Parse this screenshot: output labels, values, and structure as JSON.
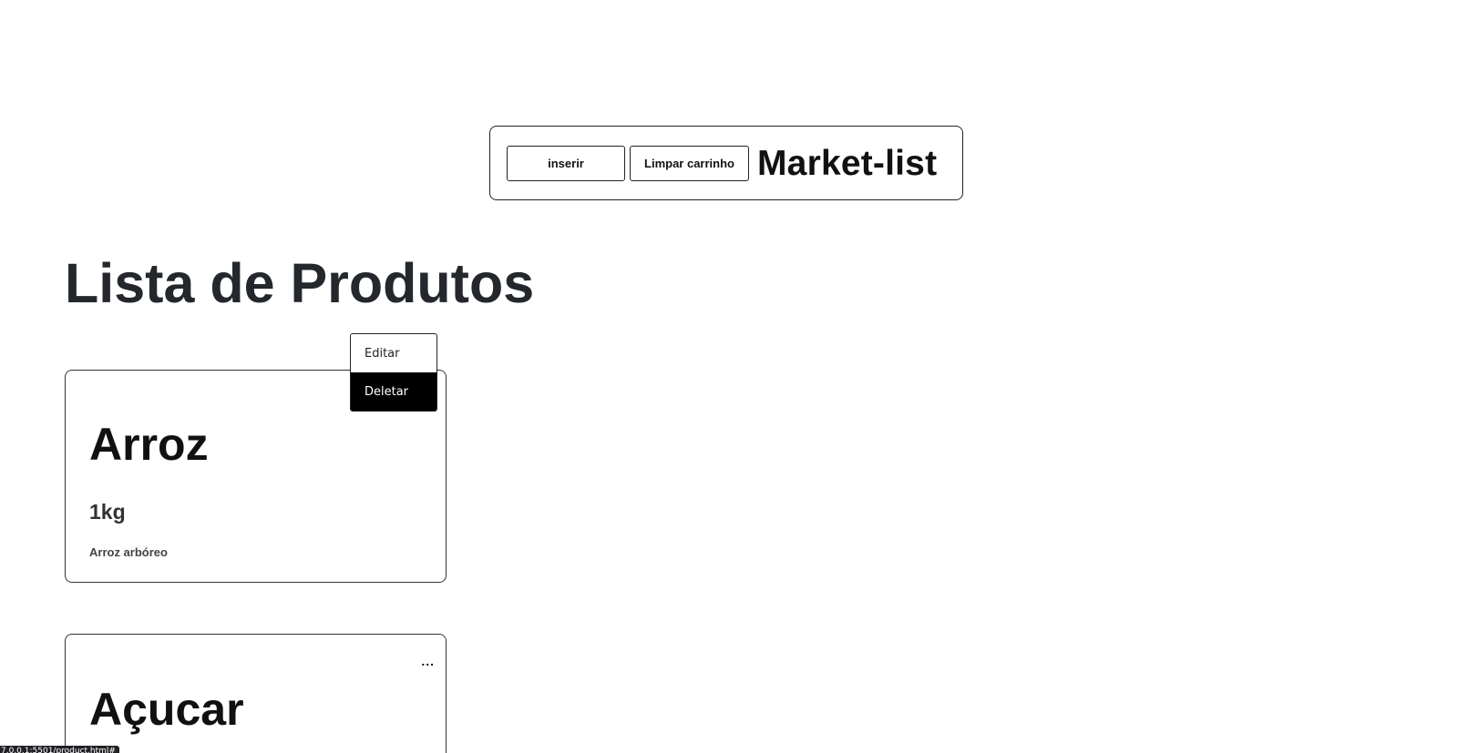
{
  "header": {
    "insert_label": "inserir",
    "clear_cart_label": "Limpar carrinho",
    "app_title": "Market-list"
  },
  "page": {
    "title": "Lista de Produtos"
  },
  "dropdown": {
    "items": [
      {
        "label": "Editar",
        "active": false
      },
      {
        "label": "Deletar",
        "active": true
      }
    ]
  },
  "products": [
    {
      "name": "Arroz",
      "quantity": "1kg",
      "description": "Arroz arbóreo",
      "menu_open": true
    },
    {
      "name": "Açucar",
      "more_label": "...",
      "menu_open": false
    }
  ],
  "status_bar": {
    "url": "7.0.0.1:5501/product.html#"
  }
}
